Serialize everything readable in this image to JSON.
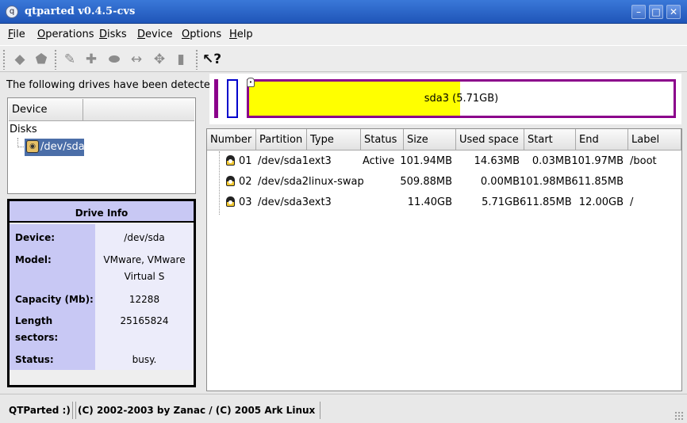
{
  "window": {
    "title": "qtparted v0.4.5-cvs",
    "buttons": [
      "minimize",
      "maximize",
      "close"
    ]
  },
  "menubar": {
    "items": [
      {
        "label": "File",
        "ul": "F",
        "rest": "ile"
      },
      {
        "label": "Operations",
        "ul": "O",
        "rest": "perations"
      },
      {
        "label": "Disks",
        "ul": "D",
        "rest": "isks"
      },
      {
        "label": "Device",
        "ul": "D",
        "rest": "evice"
      },
      {
        "label": "Options",
        "ul": "O",
        "rest": "ptions"
      },
      {
        "label": "Help",
        "ul": "H",
        "rest": "elp"
      }
    ]
  },
  "toolbar": {
    "icons": [
      "eraser-icon",
      "eraser-filled-icon",
      "wrench-icon",
      "puzzle-icon",
      "eraser-alt-icon",
      "resize-icon",
      "move-icon",
      "trash-icon",
      "whats-this-icon"
    ]
  },
  "left": {
    "detected_label": "The following drives have been detected:",
    "tree": {
      "header": "Device",
      "root": "Disks",
      "selected": "/dev/sda"
    },
    "drive_info": {
      "title": "Drive Info",
      "rows": [
        {
          "key": "Device:",
          "value": "/dev/sda"
        },
        {
          "key": "Model:",
          "value": "VMware, VMware Virtual S"
        },
        {
          "key": "Capacity (Mb):",
          "value": "12288"
        },
        {
          "key": "Length sectors:",
          "value": "25165824"
        },
        {
          "key": "Status:",
          "value": "busy."
        }
      ]
    }
  },
  "disk_map": {
    "label": "sda3 (5.71GB)",
    "used_fraction": 0.497,
    "colors": {
      "extended": "#8b008b",
      "free": "#0000cc",
      "used": "#ffff00"
    }
  },
  "partitions": {
    "columns": [
      "Number",
      "Partition",
      "Type",
      "Status",
      "Size",
      "Used space",
      "Start",
      "End",
      "Label"
    ],
    "rows": [
      {
        "number": "01",
        "partition": "/dev/sda1",
        "type": "ext3",
        "status": "Active",
        "size": "101.94MB",
        "used": "14.63MB",
        "start": "0.03MB",
        "end": "101.97MB",
        "label": "/boot"
      },
      {
        "number": "02",
        "partition": "/dev/sda2",
        "type": "linux-swap",
        "status": "",
        "size": "509.88MB",
        "used": "0.00MB",
        "start": "101.98MB",
        "end": "611.85MB",
        "label": ""
      },
      {
        "number": "03",
        "partition": "/dev/sda3",
        "type": "ext3",
        "status": "",
        "size": "11.40GB",
        "used": "5.71GB",
        "start": "611.85MB",
        "end": "12.00GB",
        "label": "/"
      }
    ]
  },
  "statusbar": {
    "left": "QTParted :)",
    "right": "(C) 2002-2003 by Zanac / (C) 2005 Ark Linux"
  }
}
